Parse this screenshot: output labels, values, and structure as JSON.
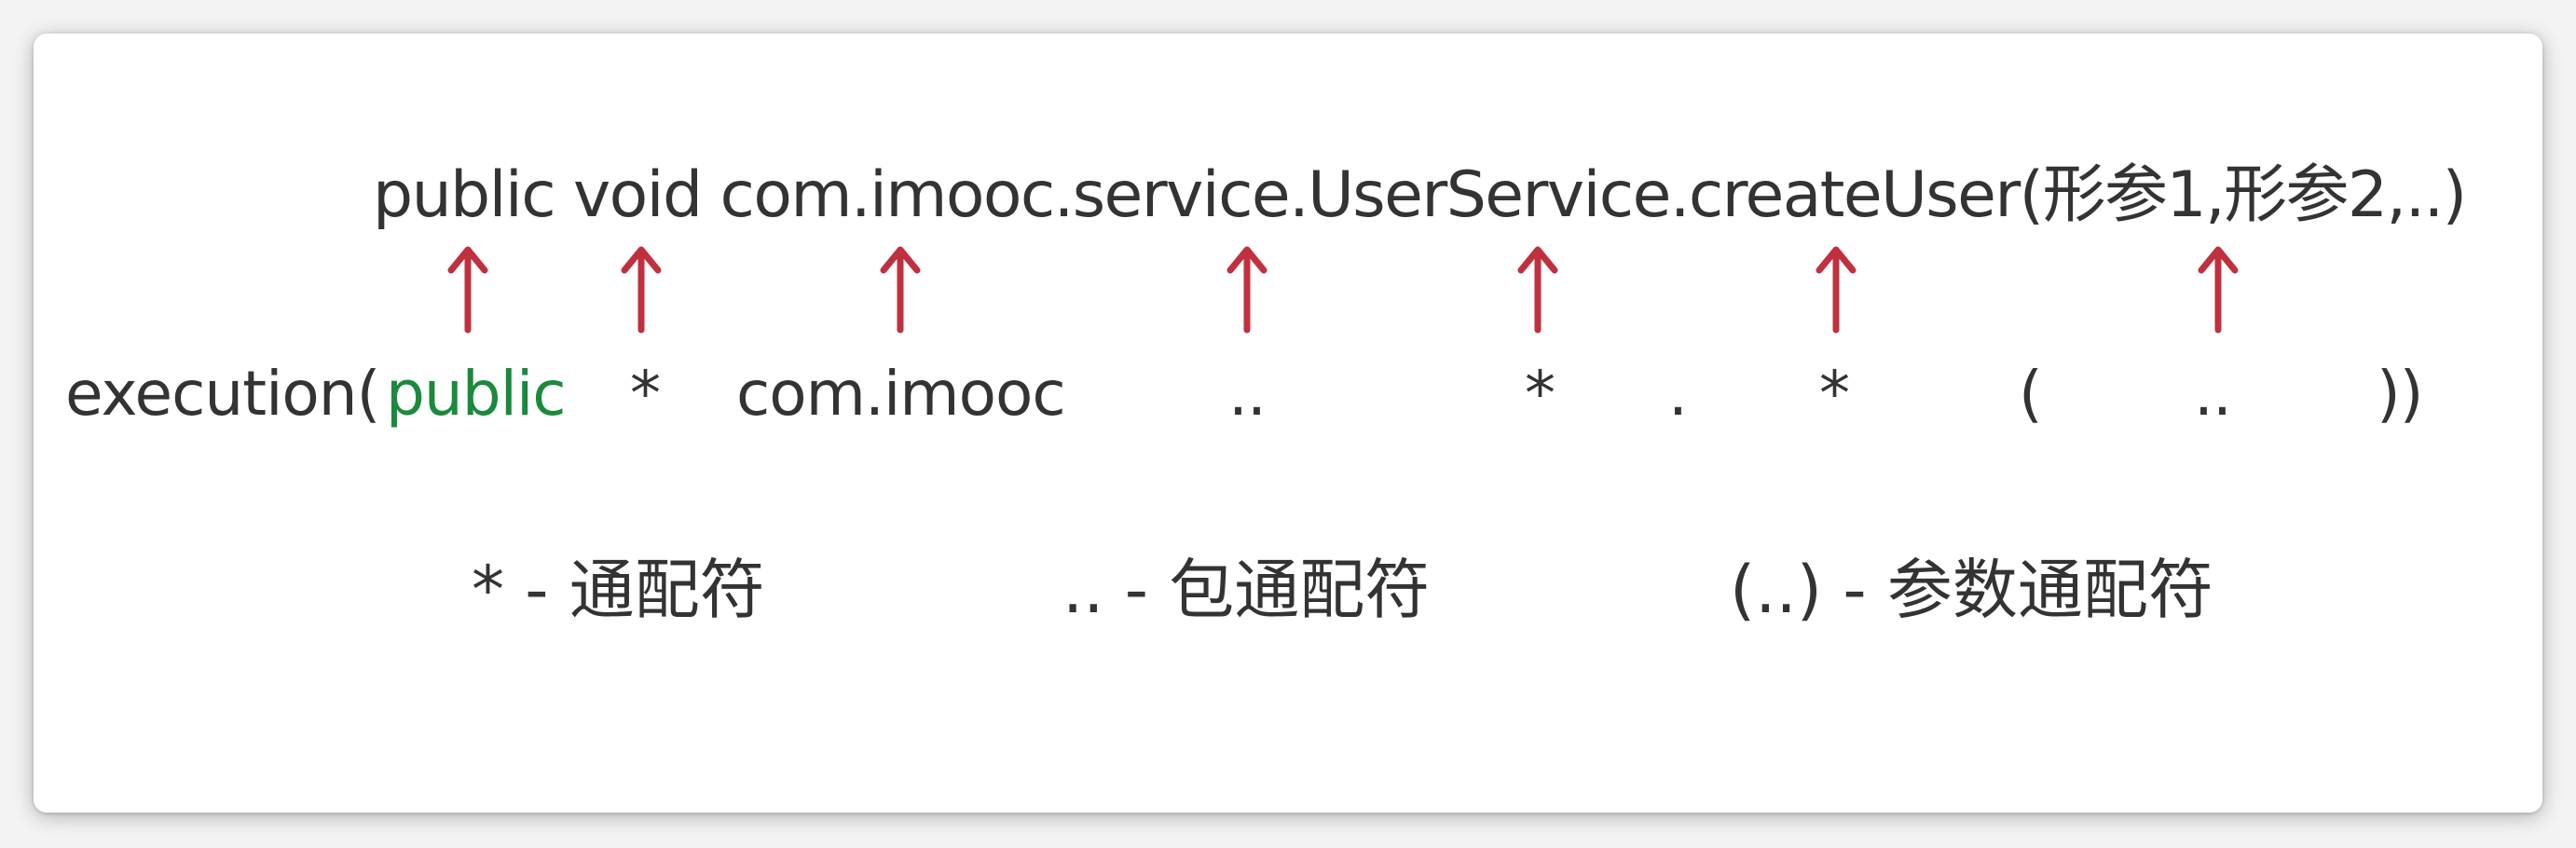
{
  "signature": "public void com.imooc.service.UserService.createUser(形参1,形参2,..)",
  "expression": {
    "prefix": "execution(",
    "modifier": "public",
    "return_wildcard": "*",
    "package_prefix": "com.imooc",
    "package_wildcard": "..",
    "class_wildcard": "*",
    "dot": ".",
    "method_wildcard": "*",
    "open_paren": "(",
    "param_wildcard": "..",
    "close_parens": "))"
  },
  "legend": [
    {
      "text": "* - 通配符"
    },
    {
      "text": ".. - 包通配符"
    },
    {
      "text": "(..) - 参数通配符"
    }
  ],
  "colors": {
    "arrow": "#c0303f",
    "keyword": "#1a8a3c",
    "text": "#333333"
  }
}
